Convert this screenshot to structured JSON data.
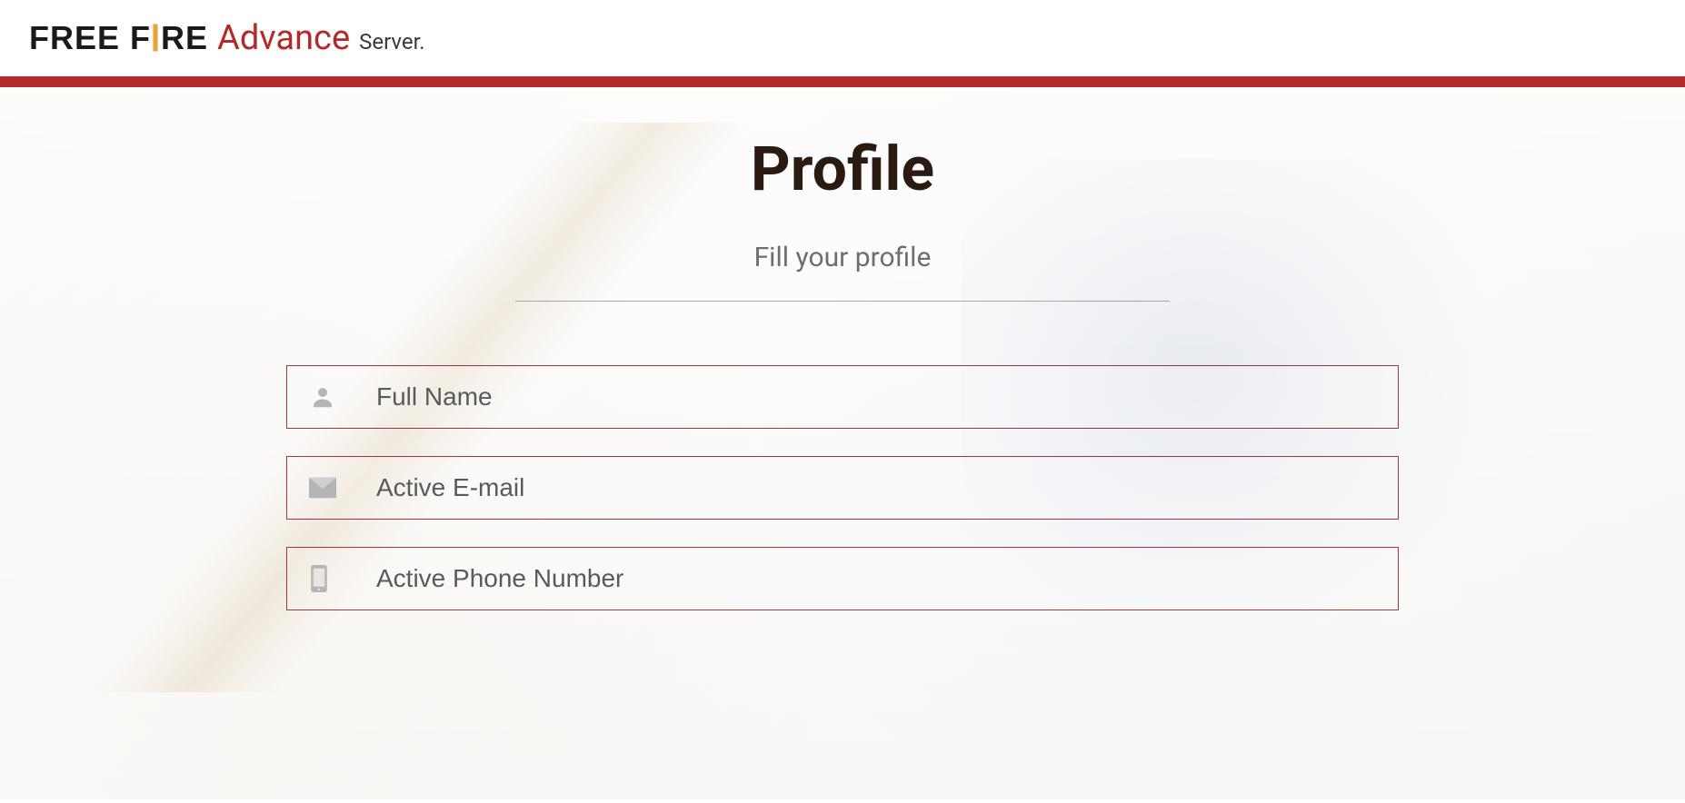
{
  "header": {
    "logo_part1a": "FREE F",
    "logo_part1b": "I",
    "logo_part1c": "RE",
    "logo_part2": "Advance",
    "logo_part3": "Server."
  },
  "page": {
    "title": "Profile",
    "subtitle": "Fill your profile"
  },
  "form": {
    "full_name": {
      "placeholder": "Full Name",
      "value": ""
    },
    "email": {
      "placeholder": "Active E-mail",
      "value": ""
    },
    "phone": {
      "placeholder": "Active Phone Number",
      "value": ""
    }
  }
}
